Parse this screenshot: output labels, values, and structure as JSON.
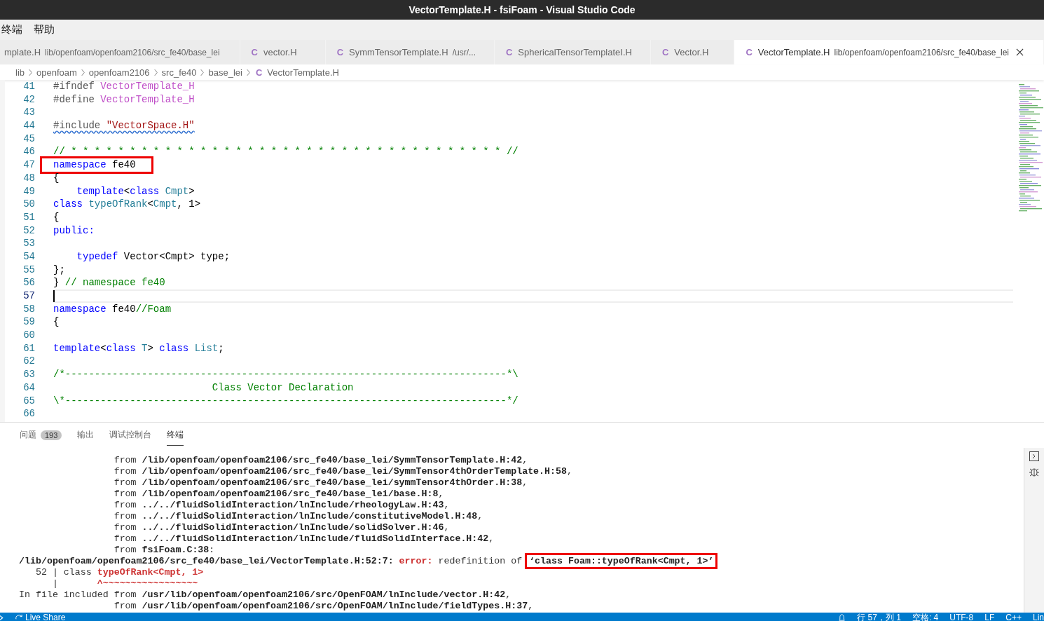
{
  "window": {
    "title": "VectorTemplate.H - fsiFoam - Visual Studio Code"
  },
  "menu": [
    "终端",
    "帮助"
  ],
  "tabs": [
    {
      "label": "mplate.H",
      "description": "lib/openfoam/openfoam2106/src_fe40/base_lei",
      "selected": false
    },
    {
      "icon": "C",
      "label": "vector.H",
      "selected": false
    },
    {
      "icon": "C",
      "label": "SymmTensorTemplate.H",
      "description": "/usr/...",
      "selected": false
    },
    {
      "icon": "C",
      "label": "SphericalTensorTemplateI.H",
      "selected": false
    },
    {
      "icon": "C",
      "label": "Vector.H",
      "selected": false
    },
    {
      "icon": "C",
      "label": "VectorTemplate.H",
      "description": "lib/openfoam/openfoam2106/src_fe40/base_lei",
      "selected": true
    }
  ],
  "breadcrumb": {
    "folders": [
      "lib",
      "openfoam",
      "openfoam2106",
      "src_fe40",
      "base_lei"
    ],
    "icon": "C",
    "file": "VectorTemplate.H"
  },
  "editor": {
    "lines": [
      {
        "number": "41",
        "tokens": [
          {
            "kind": "preproc",
            "text": "#ifndef "
          },
          {
            "kind": "macro",
            "text": "VectorTemplate_H"
          }
        ]
      },
      {
        "number": "42",
        "tokens": [
          {
            "kind": "preproc",
            "text": "#define "
          },
          {
            "kind": "macro",
            "text": "VectorTemplate_H"
          }
        ]
      },
      {
        "number": "43"
      },
      {
        "number": "44",
        "warning": true,
        "tokens": [
          {
            "kind": "preproc",
            "text": "#include "
          },
          {
            "kind": "string",
            "text": "\"VectorSpace.H\""
          }
        ]
      },
      {
        "number": "45"
      },
      {
        "number": "46",
        "tokens": [
          {
            "kind": "comment",
            "text": "// * * * * * * * * * * * * * * * * * * * * * * * * * * * * * * * * * * * * * //"
          }
        ]
      },
      {
        "number": "47",
        "boxed": true,
        "tokens": [
          {
            "kind": "keyword",
            "text": "namespace"
          },
          {
            "kind": "plain",
            "text": " fe40"
          }
        ]
      },
      {
        "number": "48",
        "tokens": [
          {
            "kind": "plain",
            "text": "{"
          }
        ]
      },
      {
        "number": "49",
        "tokens": [
          {
            "kind": "keyword",
            "text": "    template"
          },
          {
            "kind": "plain",
            "text": "<"
          },
          {
            "kind": "keyword",
            "text": "class "
          },
          {
            "kind": "type",
            "text": "Cmpt"
          },
          {
            "kind": "plain",
            "text": ">"
          }
        ]
      },
      {
        "number": "50",
        "tokens": [
          {
            "kind": "keyword",
            "text": "class "
          },
          {
            "kind": "type",
            "text": "typeOfRank"
          },
          {
            "kind": "plain",
            "text": "<"
          },
          {
            "kind": "type",
            "text": "Cmpt"
          },
          {
            "kind": "plain",
            "text": ", 1>"
          }
        ]
      },
      {
        "number": "51",
        "tokens": [
          {
            "kind": "plain",
            "text": "{"
          }
        ]
      },
      {
        "number": "52",
        "tokens": [
          {
            "kind": "keyword",
            "text": "public:"
          }
        ]
      },
      {
        "number": "53"
      },
      {
        "number": "54",
        "tokens": [
          {
            "kind": "keyword",
            "text": "    typedef"
          },
          {
            "kind": "plain",
            "text": " Vector<Cmpt> type;"
          }
        ]
      },
      {
        "number": "55",
        "tokens": [
          {
            "kind": "plain",
            "text": "};"
          }
        ]
      },
      {
        "number": "56",
        "tokens": [
          {
            "kind": "plain",
            "text": "} "
          },
          {
            "kind": "comment",
            "text": "// namespace fe40"
          }
        ]
      },
      {
        "number": "57",
        "current": true
      },
      {
        "number": "58",
        "tokens": [
          {
            "kind": "keyword",
            "text": "namespace"
          },
          {
            "kind": "plain",
            "text": " fe40"
          },
          {
            "kind": "comment",
            "text": "//Foam"
          }
        ]
      },
      {
        "number": "59",
        "tokens": [
          {
            "kind": "plain",
            "text": "{"
          }
        ]
      },
      {
        "number": "60"
      },
      {
        "number": "61",
        "tokens": [
          {
            "kind": "keyword",
            "text": "template"
          },
          {
            "kind": "plain",
            "text": "<"
          },
          {
            "kind": "keyword",
            "text": "class "
          },
          {
            "kind": "type",
            "text": "T"
          },
          {
            "kind": "plain",
            "text": "> "
          },
          {
            "kind": "keyword",
            "text": "class "
          },
          {
            "kind": "type",
            "text": "List"
          },
          {
            "kind": "plain",
            "text": ";"
          }
        ]
      },
      {
        "number": "62"
      },
      {
        "number": "63",
        "tokens": [
          {
            "kind": "comment",
            "text": "/*---------------------------------------------------------------------------*\\"
          }
        ]
      },
      {
        "number": "64",
        "tokens": [
          {
            "kind": "comment",
            "text": "                           Class Vector Declaration"
          }
        ]
      },
      {
        "number": "65",
        "tokens": [
          {
            "kind": "comment",
            "text": "\\*---------------------------------------------------------------------------*/"
          }
        ]
      },
      {
        "number": "66"
      }
    ]
  },
  "panel": {
    "tabs": [
      {
        "label": "问题",
        "badge": "193",
        "selected": false
      },
      {
        "label": "输出",
        "selected": false
      },
      {
        "label": "调试控制台",
        "selected": false
      },
      {
        "label": "终端",
        "selected": true
      }
    ],
    "terminal": [
      [
        {
          "kind": "plain",
          "text": "                 from "
        },
        {
          "kind": "bold",
          "text": "/lib/openfoam/openfoam2106/src_fe40/base_lei/SymmTensorTemplate.H:42"
        },
        {
          "kind": "plain",
          "text": ","
        }
      ],
      [
        {
          "kind": "plain",
          "text": "                 from "
        },
        {
          "kind": "bold",
          "text": "/lib/openfoam/openfoam2106/src_fe40/base_lei/SymmTensor4thOrderTemplate.H:58"
        },
        {
          "kind": "plain",
          "text": ","
        }
      ],
      [
        {
          "kind": "plain",
          "text": "                 from "
        },
        {
          "kind": "bold",
          "text": "/lib/openfoam/openfoam2106/src_fe40/base_lei/symmTensor4thOrder.H:38"
        },
        {
          "kind": "plain",
          "text": ","
        }
      ],
      [
        {
          "kind": "plain",
          "text": "                 from "
        },
        {
          "kind": "bold",
          "text": "/lib/openfoam/openfoam2106/src_fe40/base_lei/base.H:8"
        },
        {
          "kind": "plain",
          "text": ","
        }
      ],
      [
        {
          "kind": "plain",
          "text": "                 from "
        },
        {
          "kind": "bold",
          "text": "../../fluidSolidInteraction/lnInclude/rheologyLaw.H:43"
        },
        {
          "kind": "plain",
          "text": ","
        }
      ],
      [
        {
          "kind": "plain",
          "text": "                 from "
        },
        {
          "kind": "bold",
          "text": "../../fluidSolidInteraction/lnInclude/constitutiveModel.H:48"
        },
        {
          "kind": "plain",
          "text": ","
        }
      ],
      [
        {
          "kind": "plain",
          "text": "                 from "
        },
        {
          "kind": "bold",
          "text": "../../fluidSolidInteraction/lnInclude/solidSolver.H:46"
        },
        {
          "kind": "plain",
          "text": ","
        }
      ],
      [
        {
          "kind": "plain",
          "text": "                 from "
        },
        {
          "kind": "bold",
          "text": "../../fluidSolidInteraction/lnInclude/fluidSolidInterface.H:42"
        },
        {
          "kind": "plain",
          "text": ","
        }
      ],
      [
        {
          "kind": "plain",
          "text": "                 from "
        },
        {
          "kind": "bold",
          "text": "fsiFoam.C:38"
        },
        {
          "kind": "plain",
          "text": ":"
        }
      ],
      [
        {
          "kind": "bold",
          "text": "/lib/openfoam/openfoam2106/src_fe40/base_lei/VectorTemplate.H:52:7:"
        },
        {
          "kind": "error",
          "text": " error:"
        },
        {
          "kind": "plain",
          "text": " redefinition of "
        },
        {
          "kind": "bold",
          "text": "‘class Foam::typeOfRank<Cmpt, 1>’",
          "boxed": true
        }
      ],
      [
        {
          "kind": "plain",
          "text": "   52 | class "
        },
        {
          "kind": "error",
          "text": "typeOfRank<Cmpt, 1>"
        }
      ],
      [
        {
          "kind": "plain",
          "text": "      |       "
        },
        {
          "kind": "error",
          "text": "^~~~~~~~~~~~~~~~~~"
        }
      ],
      [
        {
          "kind": "plain",
          "text": "In file included from "
        },
        {
          "kind": "bold",
          "text": "/usr/lib/openfoam/openfoam2106/src/OpenFOAM/lnInclude/vector.H:42"
        },
        {
          "kind": "plain",
          "text": ","
        }
      ],
      [
        {
          "kind": "plain",
          "text": "                 from "
        },
        {
          "kind": "bold",
          "text": "/usr/lib/openfoam/openfoam2106/src/OpenFOAM/lnInclude/fieldTypes.H:37"
        },
        {
          "kind": "plain",
          "text": ","
        }
      ]
    ]
  },
  "status_bar": {
    "left": [
      "Live Share"
    ],
    "right": [
      "行 57，列 1",
      "空格: 4",
      "UTF-8",
      "LF",
      "C++",
      "Lin"
    ]
  }
}
